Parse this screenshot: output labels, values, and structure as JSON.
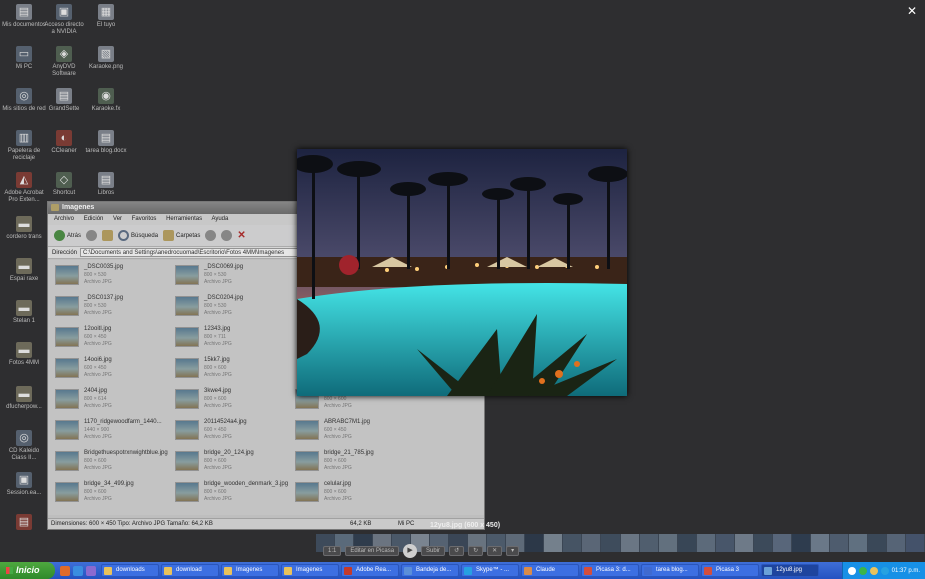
{
  "desktop": {
    "icons": [
      {
        "label": "Mis documentos",
        "glyph": "▤"
      },
      {
        "label": "Acceso directo a NVIDIA",
        "glyph": "▣"
      },
      {
        "label": "El tuyo",
        "glyph": "▦"
      },
      {
        "label": "Mi PC",
        "glyph": "▭"
      },
      {
        "label": "AnyDVD Software",
        "glyph": "◈"
      },
      {
        "label": "Karaoke.png",
        "glyph": "▧"
      },
      {
        "label": "Mis sitios de red",
        "glyph": "◎"
      },
      {
        "label": "GrandSette",
        "glyph": "▤"
      },
      {
        "label": "Karaoke.fx",
        "glyph": "◉"
      },
      {
        "label": "Papelera de reciclaje",
        "glyph": "▥"
      },
      {
        "label": "CCleaner",
        "glyph": "◐"
      },
      {
        "label": "tarea blog.docx",
        "glyph": "▤"
      },
      {
        "label": "Adobe Acrobat Pro Exten...",
        "glyph": "◭"
      },
      {
        "label": "Shortcut",
        "glyph": "◇"
      },
      {
        "label": "Libros",
        "glyph": "▤"
      },
      {
        "label": "cordero trans",
        "glyph": "▬"
      },
      {
        "label": "Espai raxe",
        "glyph": "▬"
      },
      {
        "label": "Stelan 1",
        "glyph": "▬"
      },
      {
        "label": "Fotos 4MM",
        "glyph": "▬"
      },
      {
        "label": "dfucherpow...",
        "glyph": "▬"
      },
      {
        "label": "CD Kaleido Ciass II...",
        "glyph": "◎"
      },
      {
        "label": "Session.ea...",
        "glyph": "▣"
      },
      {
        "label": "",
        "glyph": "▤"
      }
    ]
  },
  "close_label": "✕",
  "explorer": {
    "title": "Imagenes",
    "menu": [
      "Archivo",
      "Edición",
      "Ver",
      "Favoritos",
      "Herramientas",
      "Ayuda"
    ],
    "toolbar": {
      "back": "Atrás",
      "search": "Búsqueda",
      "folders": "Carpetas"
    },
    "address_label": "Dirección",
    "address": "C:\\Documents and Settings\\anedrocuomad\\Escritorio\\Fotos 4MM\\Imagenes",
    "files": [
      {
        "name": "_DSC0035.jpg",
        "dim": "800 × 530",
        "type": "Archivo JPG"
      },
      {
        "name": "_DSC0069.jpg",
        "dim": "800 × 530",
        "type": "Archivo JPG"
      },
      {
        "name": "_DSC0137.jpg",
        "dim": "800 × 530",
        "type": "Archivo JPG"
      },
      {
        "name": "_DSC0204.jpg",
        "dim": "800 × 530",
        "type": "Archivo JPG"
      },
      {
        "name": "12ooitl.jpg",
        "dim": "600 × 450",
        "type": "Archivo JPG"
      },
      {
        "name": "12343.jpg",
        "dim": "800 × 711",
        "type": "Archivo JPG"
      },
      {
        "name": "14ooi6.jpg",
        "dim": "600 × 450",
        "type": "Archivo JPG"
      },
      {
        "name": "15kk7.jpg",
        "dim": "800 × 600",
        "type": "Archivo JPG"
      },
      {
        "name": "2404.jpg",
        "dim": "800 × 614",
        "type": "Archivo JPG"
      },
      {
        "name": "3kwe4.jpg",
        "dim": "800 × 600",
        "type": "Archivo JPG"
      },
      {
        "name": "3lonut.jpg",
        "dim": "800 × 600",
        "type": "Archivo JPG"
      },
      {
        "name": "1170_ridgewoodfarm_1440...",
        "dim": "1440 × 900",
        "type": "Archivo JPG"
      },
      {
        "name": "20114524a4.jpg",
        "dim": "600 × 450",
        "type": "Archivo JPG"
      },
      {
        "name": "ABRABC7M1.jpg",
        "dim": "600 × 450",
        "type": "Archivo JPG"
      },
      {
        "name": "Bridgethuespotrxnwightblue.jpg",
        "dim": "800 × 600",
        "type": "Archivo JPG"
      },
      {
        "name": "bridge_20_124.jpg",
        "dim": "800 × 600",
        "type": "Archivo JPG"
      },
      {
        "name": "bridge_21_785.jpg",
        "dim": "800 × 600",
        "type": "Archivo JPG"
      },
      {
        "name": "bridge_34_499.jpg",
        "dim": "800 × 600",
        "type": "Archivo JPG"
      },
      {
        "name": "bridge_wooden_denmark_3.jpg",
        "dim": "800 × 600",
        "type": "Archivo JPG"
      },
      {
        "name": "celular.jpg",
        "dim": "800 × 600",
        "type": "Archivo JPG"
      }
    ],
    "status": {
      "left": "Dimensiones: 600 × 450 Tipo: Archivo JPG Tamaño: 64,2 KB",
      "size": "64,2 KB",
      "zone": "Mi PC"
    }
  },
  "viewer": {
    "caption": "12yu8.jpg (600 x 450)",
    "controls": {
      "zoom_fit": "1:1",
      "edit": "Editar en Picasa",
      "play": "▶",
      "upload": "Subir",
      "rotate_left": "↺",
      "rotate_right": "↻",
      "delete": "✕",
      "more": "▾"
    }
  },
  "taskbar": {
    "start": "Inicio",
    "tasks": [
      {
        "label": "downloads",
        "color": "#e8c25c"
      },
      {
        "label": "download",
        "color": "#e8c25c"
      },
      {
        "label": "Imagenes",
        "color": "#e8c25c"
      },
      {
        "label": "Imagenes",
        "color": "#e8c25c"
      },
      {
        "label": "Adobe Rea...",
        "color": "#c43a2a"
      },
      {
        "label": "Bandeja de...",
        "color": "#5b8fd9"
      },
      {
        "label": "Skype™ - ...",
        "color": "#27a1e1"
      },
      {
        "label": "Claude",
        "color": "#d98b4a"
      },
      {
        "label": "Picasa 3: d...",
        "color": "#d34e3c"
      },
      {
        "label": "tarea blog...",
        "color": "#3f6ad0"
      },
      {
        "label": "Picasa 3",
        "color": "#d34e3c"
      },
      {
        "label": "12yu8.jpg",
        "color": "#6aa1d8"
      }
    ],
    "clock": "01:37 p.m."
  }
}
